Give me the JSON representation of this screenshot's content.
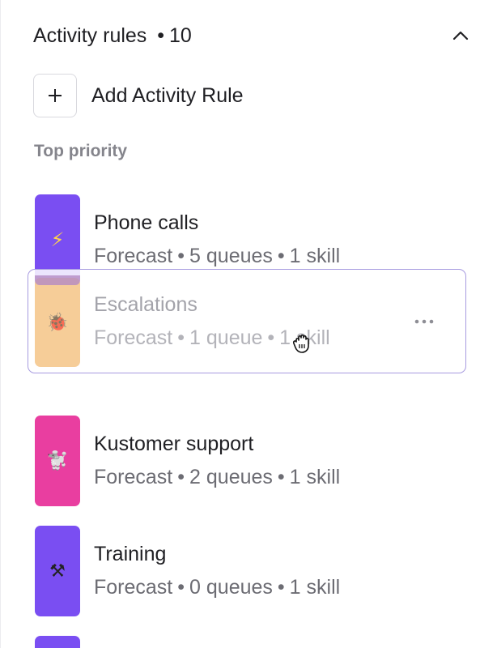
{
  "header": {
    "title": "Activity rules",
    "separator": "•",
    "count": "10"
  },
  "add_rule": {
    "icon": "plus-icon",
    "label": "Add Activity Rule"
  },
  "section": {
    "label": "Top priority"
  },
  "colors": {
    "purple": "#7a4ef2",
    "orange_faded": "#f6cd98",
    "pink": "#e93ea0",
    "drag_border": "#a79be0"
  },
  "rules": [
    {
      "name": "Phone calls",
      "icon": "lightning-bolt-icon",
      "glyph": "⚡",
      "meta": {
        "type": "Forecast",
        "queues": "5 queues",
        "skills": "1 skill"
      }
    },
    {
      "name": "Escalations",
      "icon": "ladybug-icon",
      "glyph": "🐞",
      "meta": {
        "type": "Forecast",
        "queues": "1 queue",
        "skills": "1 skill"
      },
      "dragging": true
    },
    {
      "name": "Kustomer support",
      "icon": "poodle-icon",
      "glyph": "🐩",
      "meta": {
        "type": "Forecast",
        "queues": "2 queues",
        "skills": "1 skill"
      }
    },
    {
      "name": "Training",
      "icon": "hammer-pick-icon",
      "glyph": "⚒",
      "meta": {
        "type": "Forecast",
        "queues": "0 queues",
        "skills": "1 skill"
      }
    }
  ],
  "meta_separator": "•"
}
